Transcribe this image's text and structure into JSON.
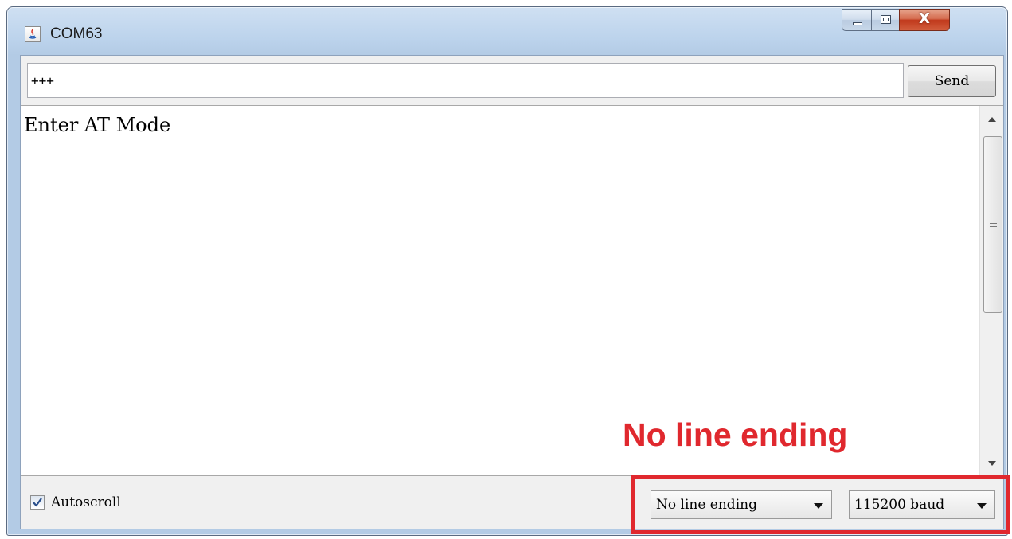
{
  "window": {
    "title": "COM63",
    "close_glyph": "X",
    "accent_color": "#e0282e"
  },
  "input": {
    "value": "+++"
  },
  "toolbar": {
    "send_label": "Send"
  },
  "output": {
    "text": "Enter AT Mode"
  },
  "footer": {
    "autoscroll_label": "Autoscroll",
    "autoscroll_checked": true,
    "line_ending_selected": "No line ending",
    "baud_selected": "115200 baud"
  },
  "annotation": {
    "text": "No line ending"
  },
  "icons": [
    "java-app-icon",
    "minimize-icon",
    "maximize-icon",
    "close-icon",
    "scroll-up-icon",
    "scroll-down-icon",
    "checkmark-icon",
    "dropdown-arrow-icon"
  ]
}
